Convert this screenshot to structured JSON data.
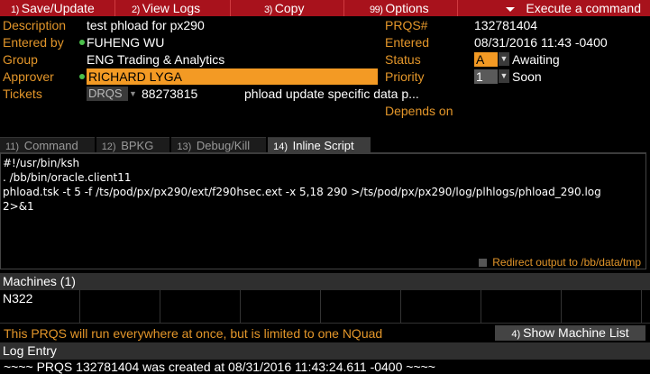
{
  "toolbar": {
    "buttons": [
      {
        "key": "1)",
        "label": "Save/Update"
      },
      {
        "key": "2)",
        "label": "View Logs"
      },
      {
        "key": "3)",
        "label": "Copy"
      },
      {
        "key": "99)",
        "label": "Options"
      }
    ],
    "execute_label": "Execute a command"
  },
  "form": {
    "description_label": "Description",
    "description_value": "test phload for px290",
    "entered_by_label": "Entered by",
    "entered_by_value": "FUHENG WU",
    "group_label": "Group",
    "group_value": "ENG Trading & Analytics",
    "approver_label": "Approver",
    "approver_value": "RICHARD LYGA",
    "tickets_label": "Tickets",
    "tickets_type": "DRQS",
    "tickets_number": "88273815",
    "tickets_desc": "phload update specific data p...",
    "prqs_label": "PRQS#",
    "prqs_value": "132781404",
    "entered_label": "Entered",
    "entered_value": "08/31/2016 11:43 -0400",
    "status_label": "Status",
    "status_code": "A",
    "status_text": "Awaiting",
    "priority_label": "Priority",
    "priority_code": "1",
    "priority_text": "Soon",
    "depends_label": "Depends on"
  },
  "tabs": [
    {
      "key": "11)",
      "label": "Command"
    },
    {
      "key": "12)",
      "label": "BPKG"
    },
    {
      "key": "13)",
      "label": "Debug/Kill"
    },
    {
      "key": "14)",
      "label": "Inline Script"
    }
  ],
  "script": {
    "lines": [
      "#!/usr/bin/ksh",
      ". /bb/bin/oracle.client11",
      "phload.tsk -t 5 -f /ts/pod/px/px290/ext/f290hsec.ext -x 5,18 290 >/ts/pod/px/px290/log/plhlogs/phload_290.log",
      "2>&1"
    ],
    "redirect_label": "Redirect output to /bb/data/tmp"
  },
  "machines": {
    "header": "Machines (1)",
    "cells": [
      "N322",
      "",
      "",
      "",
      "",
      "",
      "",
      "",
      ""
    ]
  },
  "warning": "This PRQS will run everywhere at once, but is limited to one NQuad",
  "show_machine": {
    "key": "4)",
    "label": "Show Machine List"
  },
  "log": {
    "header": "Log Entry",
    "line": "~~~~ PRQS 132781404 was created at 08/31/2016 11:43:24.611 -0400 ~~~~"
  },
  "colors": {
    "toolbar": "#a8121c",
    "label": "#e3962a",
    "highlight": "#f39a24",
    "dot": "#4bc04b"
  }
}
